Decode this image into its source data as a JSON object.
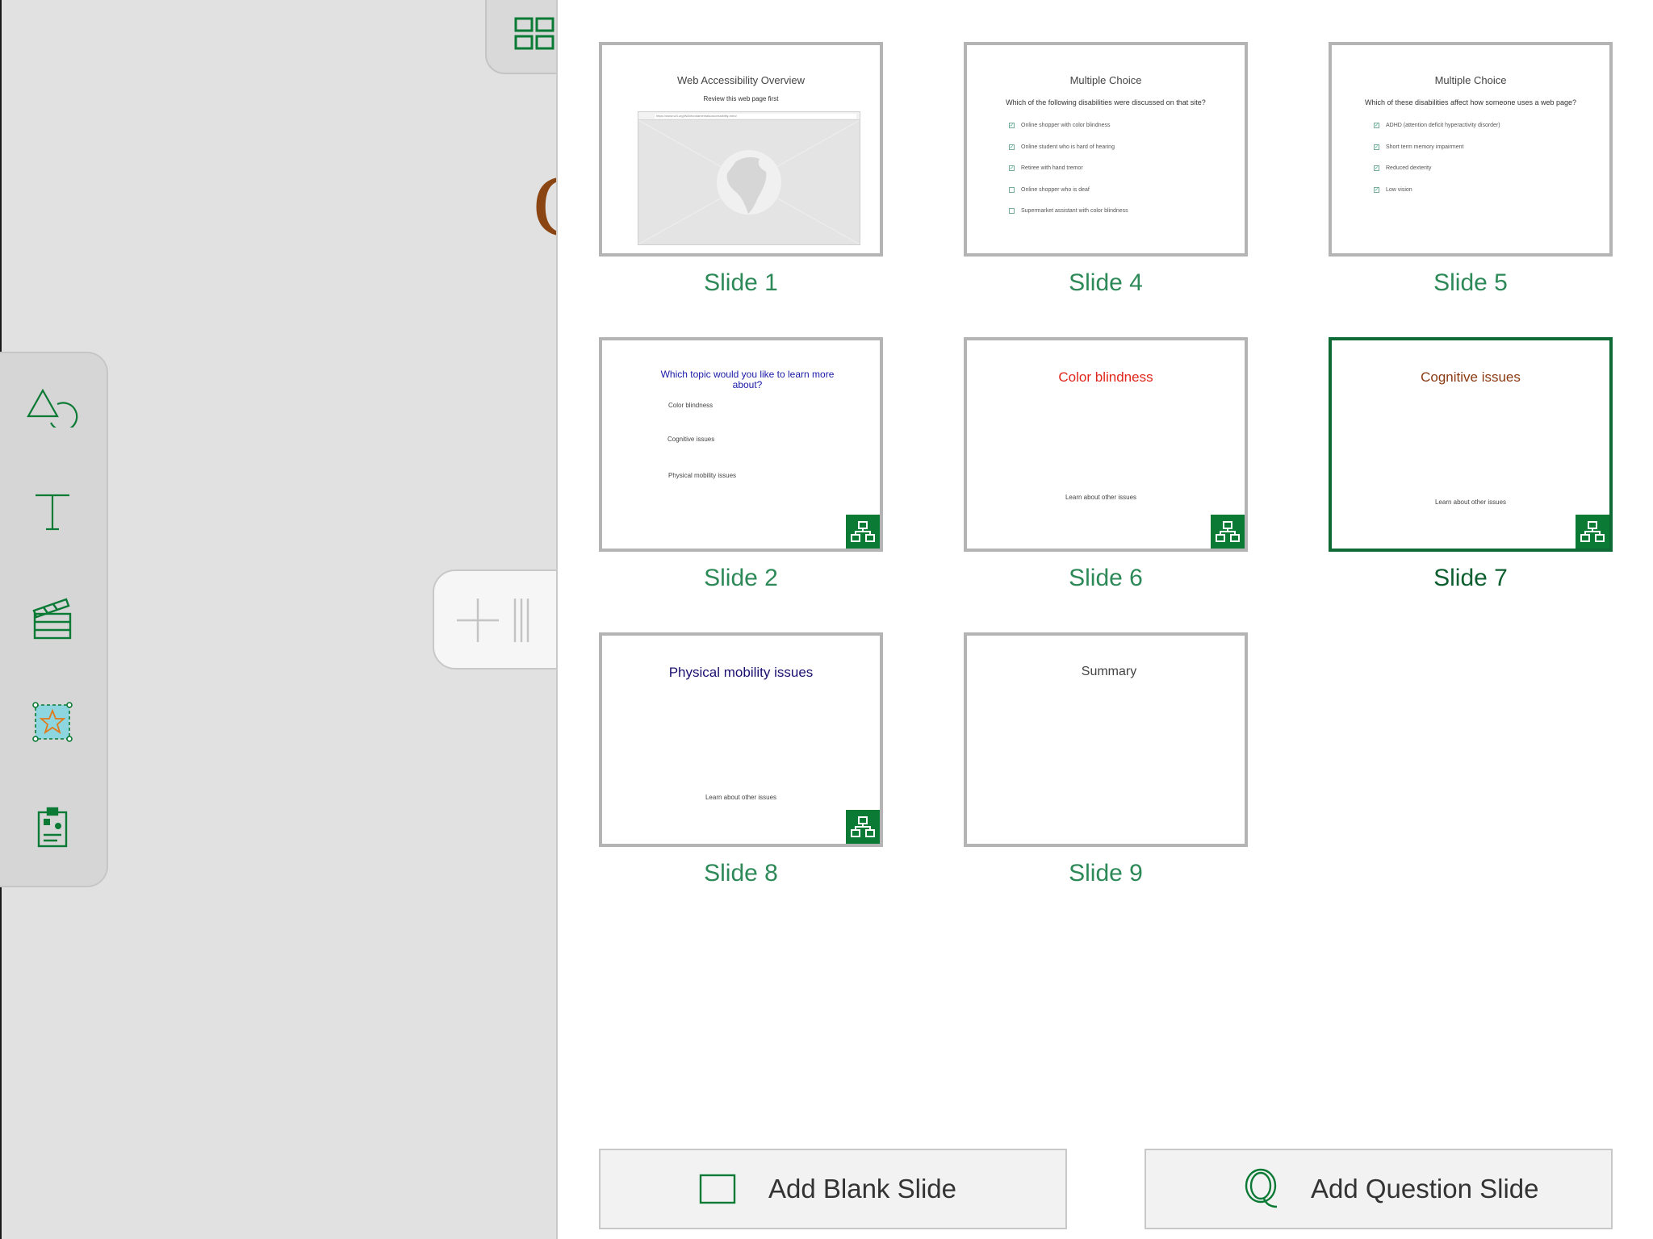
{
  "canvas": {
    "glyph": "C"
  },
  "tools": [
    {
      "name": "shapes-icon"
    },
    {
      "name": "text-icon"
    },
    {
      "name": "media-clapperboard-icon"
    },
    {
      "name": "star-image-icon"
    },
    {
      "name": "clipboard-icon"
    }
  ],
  "slides": [
    {
      "label": "Slide 1",
      "kind": "web",
      "title": "Web Accessibility Overview",
      "subtitle": "Review this web page first",
      "url": "https://www.w3.org/WAI/fundamentals/accessibility-intro/"
    },
    {
      "label": "Slide 4",
      "kind": "mc",
      "title": "Multiple Choice",
      "question": "Which of the following disabilities were discussed on that site?",
      "options": [
        {
          "text": "Online shopper with color blindness",
          "checked": true
        },
        {
          "text": "Online student who is hard of hearing",
          "checked": true
        },
        {
          "text": "Retiree with hand tremor",
          "checked": true
        },
        {
          "text": "Online shopper who is deaf",
          "checked": false
        },
        {
          "text": "Supermarket assistant with color blindness",
          "checked": false
        }
      ]
    },
    {
      "label": "Slide 5",
      "kind": "mc",
      "title": "Multiple Choice",
      "question": "Which of these disabilities affect how someone uses a web page?",
      "options": [
        {
          "text": "ADHD (attention deficit hyperactivity disorder)",
          "checked": true
        },
        {
          "text": "Short term memory impairment",
          "checked": true
        },
        {
          "text": "Reduced dexterity",
          "checked": true
        },
        {
          "text": "Low vision",
          "checked": true
        }
      ]
    },
    {
      "label": "Slide 2",
      "kind": "menu",
      "title": "Which topic would you like to learn more about?",
      "options": [
        "Color blindness",
        "Cognitive issues",
        "Physical mobility issues"
      ]
    },
    {
      "label": "Slide 6",
      "kind": "topic",
      "title": "Color blindness",
      "footer": "Learn about other issues"
    },
    {
      "label": "Slide 7",
      "kind": "topic",
      "title": "Cognitive issues",
      "footer": "Learn about other issues",
      "selected": true
    },
    {
      "label": "Slide 8",
      "kind": "topic",
      "title": "Physical mobility issues",
      "footer": "Learn about other issues"
    },
    {
      "label": "Slide 9",
      "kind": "plain",
      "title": "Summary"
    }
  ],
  "colors": {
    "accent": "#0b7a35",
    "selected_border": "#0e6b35",
    "menu_title": "#1a1aa8",
    "color_blindness": "#e0261b",
    "cognitive": "#8b3a12",
    "physical": "#1b1070",
    "summary": "#444444"
  },
  "buttons": {
    "add_blank": "Add Blank Slide",
    "add_question": "Add Question Slide"
  }
}
